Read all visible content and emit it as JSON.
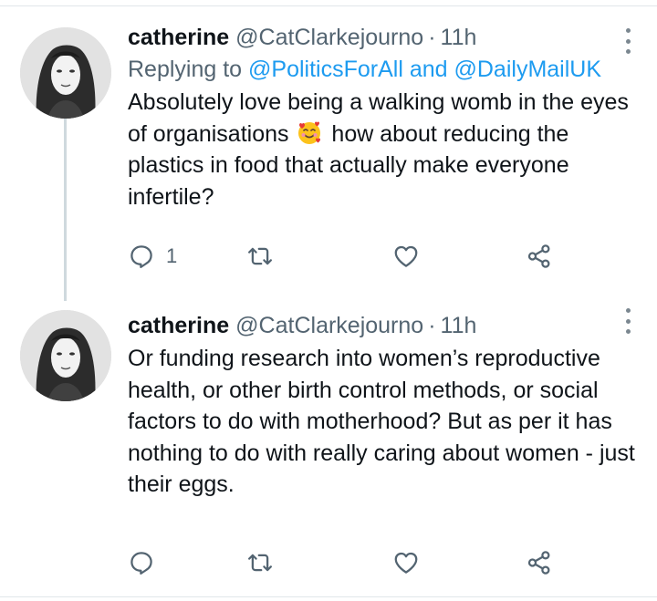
{
  "tweets": [
    {
      "name": "catherine",
      "handle": "@CatClarkejourno",
      "separator": "·",
      "time": "11h",
      "replying_prefix": "Replying to ",
      "mention_1": "@PoliticsForAll",
      "and_word": " and ",
      "mention_2": "@DailyMailUK",
      "text_part1": "Absolutely love being a walking womb in the eyes of organisations",
      "emoji": "smiling-face-with-hearts-icon",
      "text_part2": "how about reducing the plastics in food that actually make everyone infertile?",
      "reply_count": "1"
    },
    {
      "name": "catherine",
      "handle": "@CatClarkejourno",
      "separator": "·",
      "time": "11h",
      "text": "Or funding research into women’s reproductive health, or other birth control methods, or social factors to do with motherhood? But as per it has nothing to do with really caring about women - just their eggs.",
      "reply_count": ""
    }
  ],
  "colors": {
    "text": "#0f1419",
    "muted": "#536471",
    "link": "#1d9bf0",
    "thread_line": "#cfd9de"
  }
}
